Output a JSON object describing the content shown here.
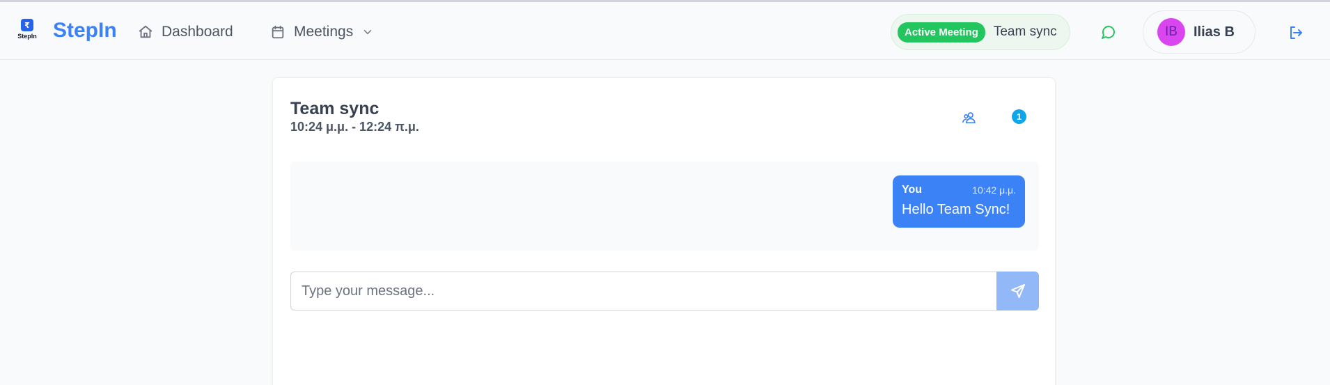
{
  "header": {
    "logo_text": "StepIn",
    "brand": "StepIn",
    "nav": {
      "dashboard_label": "Dashboard",
      "meetings_label": "Meetings"
    },
    "active_meeting": {
      "badge_label": "Active Meeting",
      "meeting_name": "Team sync"
    },
    "user": {
      "initials": "IB",
      "name": "Ilias B"
    }
  },
  "meeting": {
    "title": "Team sync",
    "time_range": "10:24 μ.μ. - 12:24 π.μ.",
    "participant_count": "1"
  },
  "messages": [
    {
      "sender": "You",
      "time": "10:42 μ.μ.",
      "text": "Hello Team Sync!"
    }
  ],
  "composer": {
    "placeholder": "Type your message...",
    "value": ""
  },
  "colors": {
    "brand": "#3b82f6",
    "active_badge": "#22c55e",
    "avatar": "#d946ef",
    "message_bubble": "#3b82f6",
    "send_button": "#93b8f8",
    "count_badge": "#0ea5e9"
  },
  "icons": [
    "home-icon",
    "calendar-icon",
    "chevron-down-icon",
    "chat-icon",
    "logout-icon",
    "users-icon",
    "send-icon"
  ]
}
